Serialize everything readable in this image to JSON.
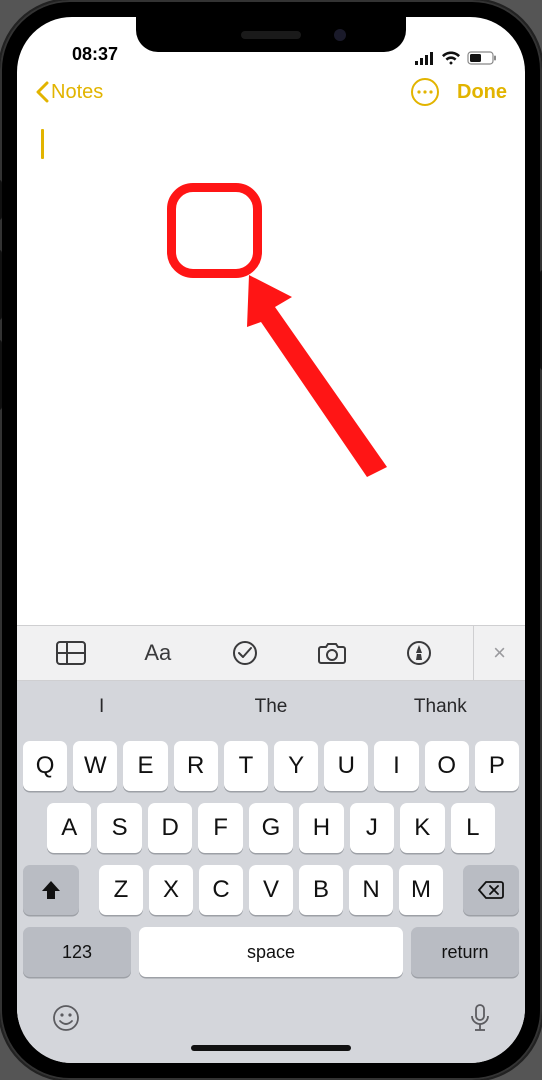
{
  "status": {
    "time": "08:37"
  },
  "nav": {
    "back_label": "Notes",
    "done_label": "Done"
  },
  "format_bar": {
    "table_icon": "table-icon",
    "text_style": "Aa",
    "checklist_icon": "checklist-icon",
    "camera_icon": "camera-icon",
    "markup_icon": "markup-icon",
    "close": "×"
  },
  "suggestions": [
    "I",
    "The",
    "Thank"
  ],
  "keyboard": {
    "row1": [
      "Q",
      "W",
      "E",
      "R",
      "T",
      "Y",
      "U",
      "I",
      "O",
      "P"
    ],
    "row2": [
      "A",
      "S",
      "D",
      "F",
      "G",
      "H",
      "J",
      "K",
      "L"
    ],
    "row3": [
      "Z",
      "X",
      "C",
      "V",
      "B",
      "N",
      "M"
    ],
    "numeric_label": "123",
    "space_label": "space",
    "return_label": "return"
  }
}
